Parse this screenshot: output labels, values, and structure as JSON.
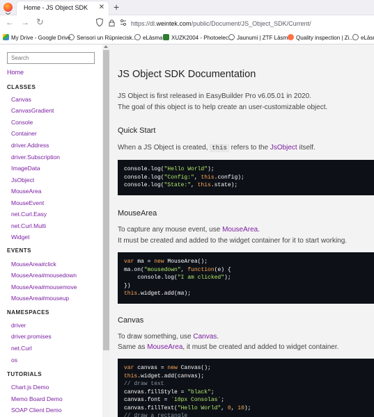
{
  "browser": {
    "tab_title": "Home - JS Object SDK",
    "tab_close": "✕",
    "new_tab": "+",
    "url_prefix": "https://dl.",
    "url_domain": "weintek.com",
    "url_suffix": "/public/Document/JS_Object_SDK/Current/",
    "bookmarks": [
      "My Drive - Google Drive",
      "Sensori un Rūpniecisk...",
      "eLāsma",
      "XUZK2004 - Photoelec...",
      "Jaunumi | ZTF Lāsma",
      "Quality inspection | Zi...",
      "eLāsm"
    ]
  },
  "sidebar": {
    "search_placeholder": "Search",
    "home": "Home",
    "sections": [
      {
        "title": "CLASSES",
        "items": [
          "Canvas",
          "CanvasGradient",
          "Console",
          "Container",
          "driver.Address",
          "driver.Subscription",
          "ImageData",
          "JsObject",
          "MouseArea",
          "MouseEvent",
          "net.Curl.Easy",
          "net.Curl.Multi",
          "Widget"
        ]
      },
      {
        "title": "EVENTS",
        "items": [
          "MouseArea#click",
          "MouseArea#mousedown",
          "MouseArea#mousemove",
          "MouseArea#mouseup"
        ]
      },
      {
        "title": "NAMESPACES",
        "items": [
          "driver",
          "driver.promises",
          "net.Curl",
          "os"
        ]
      },
      {
        "title": "TUTORIALS",
        "items": [
          "Chart.js Demo",
          "Memo Board Demo",
          "SOAP Client Demo"
        ]
      }
    ]
  },
  "content": {
    "title": "JS Object SDK Documentation",
    "intro1": "JS Object is first released in EasyBuilder Pro v6.05.01 in 2020.",
    "intro2": "The goal of this object is to help create an user-customizable object.",
    "quickstart": {
      "heading": "Quick Start",
      "text_a": "When a JS Object is created, ",
      "code_word": "this",
      "text_b": " refers to the ",
      "link": "JsObject",
      "text_c": " itself."
    },
    "mousearea": {
      "heading": "MouseArea",
      "text_a": "To capture any mouse event, use ",
      "link": "MouseArea",
      "text_b": ".",
      "text2": "It must be created and added to the widget container for it to start working."
    },
    "canvas": {
      "heading": "Canvas",
      "text_a": "To draw something, use ",
      "link": "Canvas",
      "text_b": ".",
      "text2a": "Same as ",
      "link2": "MouseArea",
      "text2b": ", it must be created and added to widget container."
    }
  },
  "colors": {
    "link": "#7b1fa2",
    "code_bg": "#0d1117",
    "content_bg": "#f3f3f3"
  }
}
